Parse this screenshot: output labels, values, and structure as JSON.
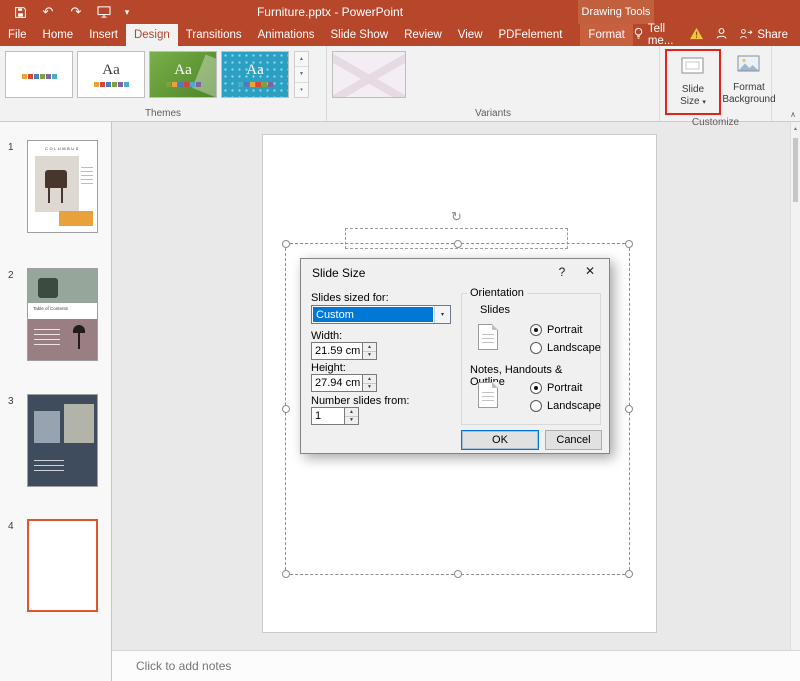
{
  "colors": {
    "titlebar": "#B7472A",
    "accent": "#0078D7",
    "annotation": "#E02418",
    "selection": "#E0542C"
  },
  "titlebar": {
    "title": "Furniture.pptx - PowerPoint",
    "context_group": "Drawing Tools",
    "tell_me": "Tell me...",
    "share_label": "Share"
  },
  "tabs": {
    "items": [
      {
        "label": "File"
      },
      {
        "label": "Home"
      },
      {
        "label": "Insert"
      },
      {
        "label": "Design"
      },
      {
        "label": "Transitions"
      },
      {
        "label": "Animations"
      },
      {
        "label": "Slide Show"
      },
      {
        "label": "Review"
      },
      {
        "label": "View"
      },
      {
        "label": "PDFelement"
      },
      {
        "label": "Format"
      }
    ]
  },
  "ribbon": {
    "themes_label": "Themes",
    "variants_label": "Variants",
    "customize_label": "Customize",
    "theme_glyph": "Aa",
    "slide_size_line1": "Slide",
    "slide_size_line2": "Size",
    "format_background_line1": "Format",
    "format_background_line2": "Background"
  },
  "slide_panel": {
    "slides": [
      {
        "number": "1",
        "title": "COLUMBUS"
      },
      {
        "number": "2",
        "title": "Table of Contents"
      },
      {
        "number": "3",
        "title": ""
      },
      {
        "number": "4",
        "title": ""
      }
    ]
  },
  "dialog": {
    "title": "Slide Size",
    "sized_for_label": "Slides sized for:",
    "sized_for_value": "Custom",
    "width_label": "Width:",
    "width_value": "21.59 cm",
    "height_label": "Height:",
    "height_value": "27.94 cm",
    "number_from_label": "Number slides from:",
    "number_from_value": "1",
    "orientation_label": "Orientation",
    "slides_label": "Slides",
    "portrait_label": "Portrait",
    "landscape_label": "Landscape",
    "slides_orientation": "Portrait",
    "notes_orientation": "Portrait",
    "notes_label": "Notes, Handouts & Outline",
    "ok_label": "OK",
    "cancel_label": "Cancel"
  },
  "notes_pane": {
    "placeholder": "Click to add notes"
  },
  "glyphs": {
    "undo": "↶",
    "redo": "↷",
    "qat_dropdown": "▾",
    "dropdown": "▾",
    "spin_up": "▲",
    "spin_down": "▼",
    "gallery_up": "▲",
    "gallery_down": "▼",
    "gallery_more": "▾",
    "scroll_up": "▲",
    "collapse": "∧",
    "rotate": "↻",
    "help": "?",
    "close": "✕"
  }
}
